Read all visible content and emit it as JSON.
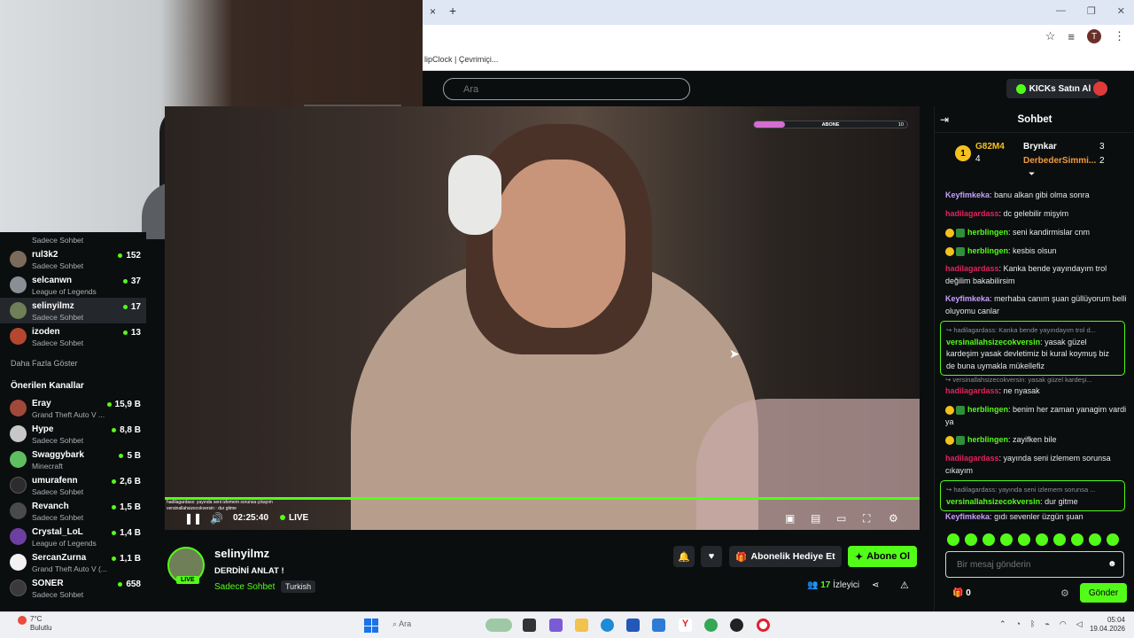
{
  "browser": {
    "tab_close": "×",
    "tab_new": "+",
    "bookmark_text": "lipClock | Çevrimiçi...",
    "window_controls": [
      "—",
      "❐",
      "✕"
    ],
    "profile_letter": "T"
  },
  "site": {
    "search_placeholder": "Ara",
    "kicks_button": "KICKs Satın Al"
  },
  "sidebar": {
    "top_cut_sub": "Sadece Sohbet",
    "following": [
      {
        "name": "rul3k2",
        "sub": "Sadece Sohbet",
        "count": "152",
        "color": "#7a6b5c"
      },
      {
        "name": "selcanwn",
        "sub": "League of Legends",
        "count": "37",
        "color": "#8a8f95"
      },
      {
        "name": "selinyilmz",
        "sub": "Sadece Sohbet",
        "count": "17",
        "color": "#6f7f57",
        "active": true
      },
      {
        "name": "izoden",
        "sub": "Sadece Sohbet",
        "count": "13",
        "color": "#b4472e"
      }
    ],
    "show_more": "Daha Fazla Göster",
    "recommended_title": "Önerilen Kanallar",
    "recommended": [
      {
        "name": "Eray",
        "sub": "Grand Theft Auto V ...",
        "count": "15,9 B",
        "color": "#a0493a"
      },
      {
        "name": "Hype",
        "sub": "Sadece Sohbet",
        "count": "8,8 B",
        "color": "#c7c7c7"
      },
      {
        "name": "Swaggybark",
        "sub": "Minecraft",
        "count": "5 B",
        "color": "#5fbf60"
      },
      {
        "name": "umurafenn",
        "sub": "Sadece Sohbet",
        "count": "2,6 B",
        "color": "#2c2c2c"
      },
      {
        "name": "Revanch",
        "sub": "Sadece Sohbet",
        "count": "1,5 B",
        "color": "#4a4a4a"
      },
      {
        "name": "Crystal_LoL",
        "sub": "League of Legends",
        "count": "1,4 B",
        "color": "#6c3fa0"
      },
      {
        "name": "SercanZurna",
        "sub": "Grand Theft Auto V (...",
        "count": "1,1 B",
        "color": "#f2f2f2"
      },
      {
        "name": "SONER",
        "sub": "Sadece Sohbet",
        "count": "658",
        "color": "#3a3a3a"
      }
    ]
  },
  "video": {
    "sub_goal_label": "ABONE",
    "sub_goal_num": "10",
    "sub_goal_progress": 0.2,
    "mini_chat_1": "hadilagardass: yayında seni izlemem sorunsa çıkayım",
    "mini_chat_2": "versinallahsizecokversin : dur gitme",
    "time": "02:25:40",
    "live": "LIVE"
  },
  "stream": {
    "streamer": "selinyilmz",
    "live_badge": "LIVE",
    "title": "DERDİNİ ANLAT !",
    "category": "Sadece Sohbet",
    "tag": "Turkish",
    "gift_button": "Abonelik Hediye Et",
    "follow_button": "Abone Ol",
    "viewers_count": "17",
    "viewers_label": "İzleyici"
  },
  "chat": {
    "title": "Sohbet",
    "pinned": {
      "rank_badge": "1",
      "user1": "G82M4",
      "user1_count": "4",
      "user2": "Brynkar",
      "user2_count": "3",
      "user3": "DerbederSimmi...",
      "user3_count": "2"
    },
    "messages": [
      {
        "user": "Keyfimkeka",
        "color": "#c6a0ff",
        "text": "banu alkan gibi olma sonra"
      },
      {
        "user": "hadilagardass",
        "color": "#e0245e",
        "text": "dc gelebilir mişyim"
      },
      {
        "user": "herblingen",
        "color": "#53fc18",
        "text": "seni kandirmislar cnm"
      },
      {
        "user": "herblingen",
        "color": "#53fc18",
        "text": "kesbis olsun"
      },
      {
        "user": "hadilagardass",
        "color": "#e0245e",
        "text": "Kanka bende yayındayım trol değilim bakabilirsim"
      },
      {
        "user": "Keyfimkeka",
        "color": "#c6a0ff",
        "text": "merhaba canım şuan güllüyorum belli oluyomu canlar"
      },
      {
        "user": "hadilagardass",
        "color": "#e0245e",
        "text": "ne nyasak"
      },
      {
        "user": "herblingen",
        "color": "#53fc18",
        "text": "benim her zaman yanagim vardi ya"
      },
      {
        "user": "herblingen",
        "color": "#53fc18",
        "text": "zayifken bile"
      },
      {
        "user": "hadilagardass",
        "color": "#e0245e",
        "text": "yayında seni izlemem sorunsa cıkayım"
      },
      {
        "user": "Keyfimkeka",
        "color": "#c6a0ff",
        "text": "gıdı sevenler üzgün şuan"
      }
    ],
    "reply1": {
      "ref": "↪ hadilagardass: Kanka bende yayındayım trol d...",
      "user": "versinallahsizecokversin",
      "color": "#53fc18",
      "text": "yasak güzel kardeşim yasak devletimiz bi kural koymuş biz de buna uymakla mükellefiz"
    },
    "reply2_ref": "↪ versinallahsizecokversin: yasak güzel kardeşi...",
    "reply3": {
      "ref": "↪ hadilagardass: yayında seni izlemem sorunsa ...",
      "user": "versinallahsizecokversin",
      "color": "#53fc18",
      "text": "dur gitme"
    },
    "input_placeholder": "Bir mesaj gönderin",
    "kicks_count": "0",
    "send_button": "Gönder"
  },
  "taskbar": {
    "weather_temp": "7°C",
    "weather_text": "Bulutlu",
    "search": "Ara",
    "time": "05:04",
    "date": "19.04.2026"
  }
}
